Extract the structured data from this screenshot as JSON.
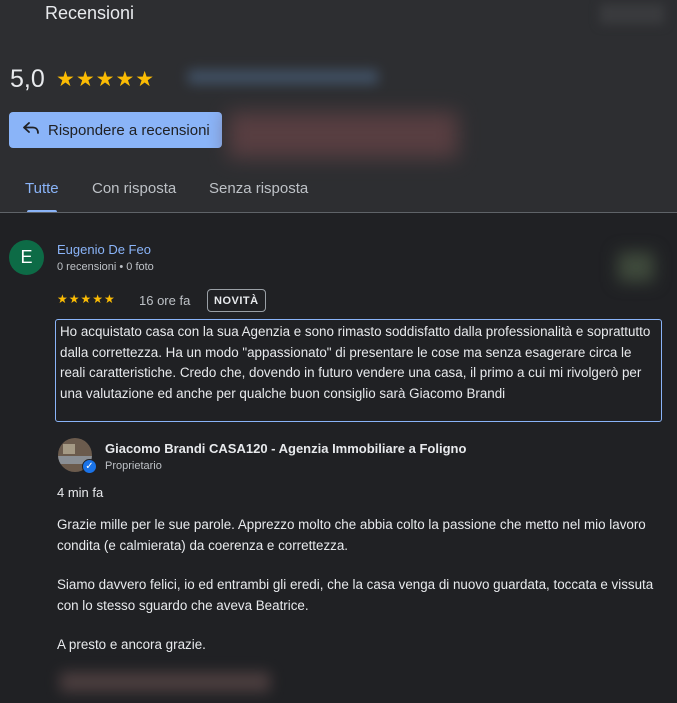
{
  "header": {
    "title": "Recensioni"
  },
  "summary": {
    "rating": "5,0",
    "stars": "★★★★★"
  },
  "actions": {
    "reply_button": "Rispondere a recensioni",
    "reply_icon": "reply-arrow-icon"
  },
  "tabs": [
    {
      "label": "Tutte",
      "active": true
    },
    {
      "label": "Con risposta",
      "active": false
    },
    {
      "label": "Senza risposta",
      "active": false
    }
  ],
  "review": {
    "avatar_letter": "E",
    "avatar_color": "#0d6b46",
    "author": "Eugenio De Feo",
    "author_meta": "0 recensioni • 0 foto",
    "stars": "★★★★★",
    "time": "16 ore fa",
    "badge": "NOVITÀ",
    "text": "Ho acquistato casa con la sua Agenzia e sono rimasto soddisfatto dalla professionalità e soprattutto dalla correttezza. Ha un modo \"appassionato\" di presentare le cose ma senza esagerare circa le reali caratteristiche. Credo che, dovendo in futuro vendere una casa, il primo a cui mi rivolgerò per una valutazione ed anche per qualche buon consiglio sarà Giacomo Brandi"
  },
  "owner_reply": {
    "name": "Giacomo Brandi CASA120 - Agenzia Immobiliare a Foligno",
    "role": "Proprietario",
    "time": "4 min fa",
    "paragraphs": [
      "Grazie mille per le sue parole. Apprezzo molto che abbia colto la passione che metto nel mio lavoro condita (e calmierata) da coerenza e correttezza.",
      "Siamo davvero felici, io ed entrambi gli eredi, che la casa venga di nuovo guardata, toccata e vissuta con lo stesso sguardo che aveva Beatrice.",
      "A presto e ancora grazie."
    ]
  },
  "colors": {
    "accent": "#8ab4f8",
    "star": "#fbbc04",
    "background": "#202124"
  }
}
